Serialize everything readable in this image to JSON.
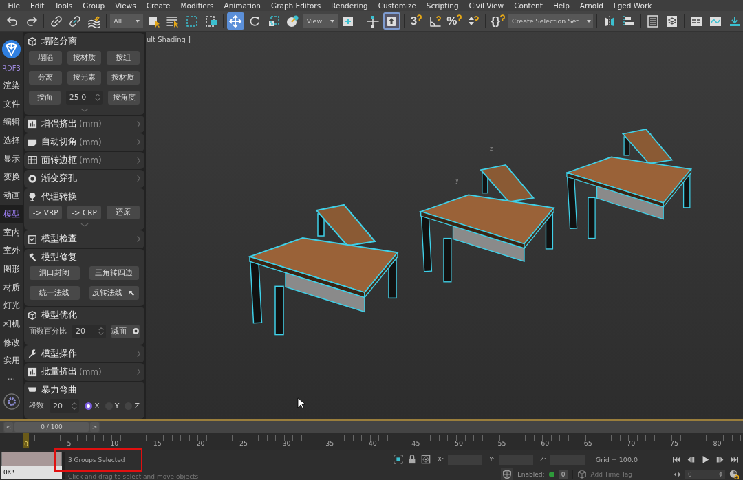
{
  "menu": [
    "File",
    "Edit",
    "Tools",
    "Group",
    "Views",
    "Create",
    "Modifiers",
    "Animation",
    "Graph Editors",
    "Rendering",
    "Customize",
    "Scripting",
    "Civil View",
    "Content",
    "Help",
    "Arnold",
    "Lged Work"
  ],
  "toolbar": [
    {
      "kind": "undo",
      "selected": false
    },
    {
      "kind": "redo",
      "selected": false
    },
    {
      "kind": "separator"
    },
    {
      "kind": "link",
      "selected": false
    },
    {
      "kind": "unlink",
      "selected": false
    },
    {
      "kind": "bind",
      "selected": false
    },
    {
      "kind": "separator"
    },
    {
      "kind": "dropdown",
      "value": "All"
    },
    {
      "kind": "select",
      "selected": false
    },
    {
      "kind": "select-list",
      "selected": false
    },
    {
      "kind": "region",
      "selected": false
    },
    {
      "kind": "window",
      "selected": false
    },
    {
      "kind": "separator"
    },
    {
      "kind": "move",
      "selected": true
    },
    {
      "kind": "rotate",
      "selected": false
    },
    {
      "kind": "scale",
      "selected": false
    },
    {
      "kind": "placement",
      "selected": false
    },
    {
      "kind": "dropdown",
      "value": "View"
    },
    {
      "kind": "pivot",
      "selected": false
    },
    {
      "kind": "separator"
    },
    {
      "kind": "manipulate",
      "selected": false
    },
    {
      "kind": "shortcut",
      "selected": true
    },
    {
      "kind": "separator"
    },
    {
      "kind": "snap",
      "glyph": "3",
      "selected": false
    },
    {
      "kind": "angle-snap",
      "selected": false
    },
    {
      "kind": "percent-snap",
      "glyph": "%",
      "selected": false
    },
    {
      "kind": "spinner-snap",
      "selected": false
    },
    {
      "kind": "separator"
    },
    {
      "kind": "named-sets",
      "glyph": "{}",
      "selected": false
    },
    {
      "kind": "dropdown",
      "value": "Create Selection Set"
    },
    {
      "kind": "separator"
    },
    {
      "kind": "mirror",
      "selected": false
    },
    {
      "kind": "align",
      "selected": false
    },
    {
      "kind": "separator"
    },
    {
      "kind": "explorer",
      "selected": false
    },
    {
      "kind": "layers",
      "selected": false
    },
    {
      "kind": "separator"
    },
    {
      "kind": "ribbon",
      "selected": false
    },
    {
      "kind": "curve",
      "selected": false
    },
    {
      "kind": "download",
      "selected": false
    }
  ],
  "rail": {
    "logo_text": "RDF3",
    "items": [
      {
        "label": "渲染",
        "selected": false
      },
      {
        "label": "文件",
        "selected": false
      },
      {
        "label": "编辑",
        "selected": false
      },
      {
        "label": "选择",
        "selected": false
      },
      {
        "label": "显示",
        "selected": false
      },
      {
        "label": "变换",
        "selected": false
      },
      {
        "label": "动画",
        "selected": false
      },
      {
        "label": "模型",
        "selected": true
      },
      {
        "label": "室内",
        "selected": false
      },
      {
        "label": "室外",
        "selected": false
      },
      {
        "label": "图形",
        "selected": false
      },
      {
        "label": "材质",
        "selected": false
      },
      {
        "label": "灯光",
        "selected": false
      },
      {
        "label": "相机",
        "selected": false
      },
      {
        "label": "修改",
        "selected": false
      },
      {
        "label": "实用",
        "selected": false
      }
    ],
    "more": "..."
  },
  "panel": [
    {
      "title": "塌陷分离",
      "expanded": true,
      "footer_chevron": true,
      "rows": [
        [
          {
            "kind": "button",
            "label": "塌陷"
          },
          {
            "kind": "button",
            "label": "按材质"
          },
          {
            "kind": "button",
            "label": "按组"
          }
        ],
        [
          {
            "kind": "button",
            "label": "分离"
          },
          {
            "kind": "button",
            "label": "按元素"
          },
          {
            "kind": "button",
            "label": "按材质"
          }
        ],
        [
          {
            "kind": "button",
            "label": "按面"
          },
          {
            "kind": "spinner",
            "value": "25.0"
          },
          {
            "kind": "button",
            "label": "按角度"
          }
        ]
      ]
    },
    {
      "title": "增强挤出",
      "unit": "(mm)",
      "expanded": false
    },
    {
      "title": "自动切角",
      "unit": "(mm)",
      "expanded": false
    },
    {
      "title": "面转边框",
      "unit": "(mm)",
      "expanded": false
    },
    {
      "title": "渐变穿孔",
      "expanded": false
    },
    {
      "title": "代理转换",
      "expanded": true,
      "footer_chevron": true,
      "rows": [
        [
          {
            "kind": "button",
            "label": "-> VRP"
          },
          {
            "kind": "button",
            "label": "-> CRP"
          },
          {
            "kind": "button",
            "label": "还原"
          }
        ]
      ]
    },
    {
      "title": "模型检查",
      "expanded": false
    },
    {
      "title": "模型修复",
      "expanded": true,
      "rows": [
        [
          {
            "kind": "button",
            "label": "洞口封闭"
          },
          {
            "kind": "button",
            "label": "三角转四边"
          }
        ],
        [
          {
            "kind": "button",
            "label": "统一法线"
          },
          {
            "kind": "button",
            "label": "反转法线"
          }
        ]
      ]
    },
    {
      "title": "模型优化",
      "expanded": true,
      "rows": [
        [
          {
            "kind": "text",
            "label": "面数百分比"
          },
          {
            "kind": "spinner",
            "value": "20"
          },
          {
            "kind": "button",
            "label": "减面"
          }
        ]
      ]
    },
    {
      "title": "模型操作",
      "expanded": false
    },
    {
      "title": "批量挤出",
      "unit": "(mm)",
      "expanded": false
    },
    {
      "title": "暴力弯曲",
      "expanded": true,
      "rows": [
        [
          {
            "kind": "text",
            "label": "段数"
          },
          {
            "kind": "spinner",
            "value": "20"
          },
          {
            "kind": "radio",
            "label": "X",
            "selected": true
          },
          {
            "kind": "radio",
            "label": "Y",
            "selected": false
          },
          {
            "kind": "radio",
            "label": "Z",
            "selected": false
          }
        ]
      ]
    }
  ],
  "viewport": {
    "label": "ult Shading ]",
    "axis_labels": [
      "z",
      "y"
    ]
  },
  "time_slider": {
    "prev": "<",
    "label": "0 / 100",
    "next": ">",
    "level": 0
  },
  "ruler": [
    {
      "label": "0",
      "selected": true
    },
    {
      "label": "5",
      "selected": false
    },
    {
      "label": "10",
      "selected": false
    },
    {
      "label": "15",
      "selected": false
    },
    {
      "label": "20",
      "selected": false
    },
    {
      "label": "25",
      "selected": false
    },
    {
      "label": "30",
      "selected": false
    },
    {
      "label": "35",
      "selected": false
    },
    {
      "label": "40",
      "selected": false
    },
    {
      "label": "45",
      "selected": false
    },
    {
      "label": "50",
      "selected": false
    },
    {
      "label": "55",
      "selected": false
    },
    {
      "label": "60",
      "selected": false
    },
    {
      "label": "65",
      "selected": false
    },
    {
      "label": "70",
      "selected": false
    },
    {
      "label": "75",
      "selected": false
    },
    {
      "label": "80",
      "selected": false
    }
  ],
  "status": {
    "listener_output": "OK!",
    "prompt": "3 Groups Selected",
    "prompt_highlighted": true,
    "hint": "Click and drag to select and move objects",
    "coords": [
      {
        "label": "X:"
      },
      {
        "label": "Y:"
      },
      {
        "label": "Z:"
      }
    ],
    "grid": "Grid = 100.0",
    "enabled_label": "Enabled:",
    "enabled_on": true,
    "key_count": "0",
    "time_tag": "Add Time Tag",
    "frame": "0"
  }
}
